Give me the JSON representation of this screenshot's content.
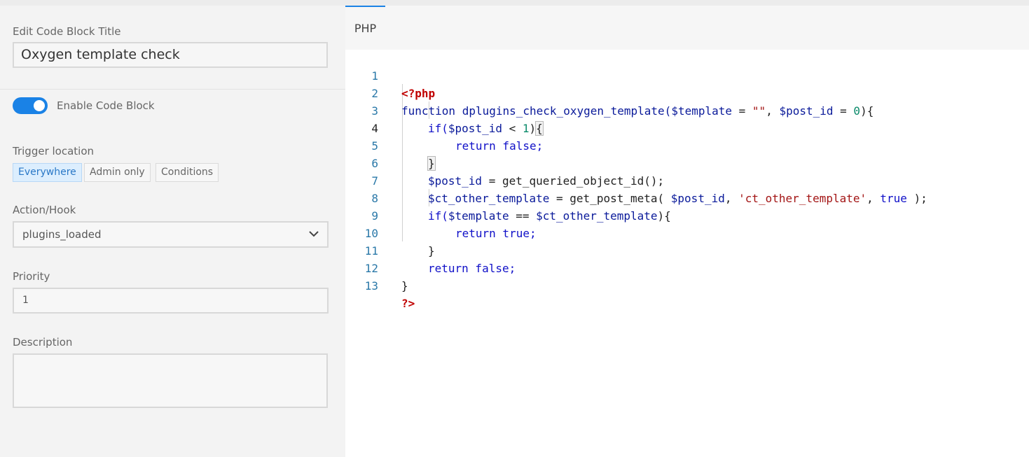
{
  "left": {
    "title_label": "Edit Code Block Title",
    "title_value": "Oxygen template check",
    "enable_label": "Enable Code Block",
    "trigger_label": "Trigger location",
    "trigger_options": [
      "Everywhere",
      "Admin only",
      "Conditions"
    ],
    "action_label": "Action/Hook",
    "action_value": "plugins_loaded",
    "priority_label": "Priority",
    "priority_value": "1",
    "description_label": "Description",
    "description_value": ""
  },
  "editor": {
    "tab": "PHP",
    "lines": [
      "1",
      "2",
      "3",
      "4",
      "5",
      "6",
      "7",
      "8",
      "9",
      "10",
      "11",
      "12",
      "13"
    ],
    "code": {
      "l1": "<?php",
      "l2_fn": "function dplugins_check_oxygen_template(",
      "l2_v1": "$template",
      "l2_eq": " = ",
      "l2_s": "\"\"",
      "l2_c": ", ",
      "l2_v2": "$post_id",
      "l2_eq2": " = ",
      "l2_n": "0",
      "l2_end": "){",
      "l3_kw": "if(",
      "l3_v": "$post_id",
      "l3_op": " < ",
      "l3_n": "1",
      "l3_end": ")",
      "l3_br": "{",
      "l4": "return false;",
      "l5": "}",
      "l6_v": "$post_id",
      "l6_rest": " = get_queried_object_id();",
      "l7_v": "$ct_other_template",
      "l7_mid": " = get_post_meta( ",
      "l7_v2": "$post_id",
      "l7_c": ", ",
      "l7_s": "'ct_other_template'",
      "l7_c2": ", ",
      "l7_t": "true",
      "l7_end": " );",
      "l8_kw": "if(",
      "l8_v": "$template",
      "l8_op": " == ",
      "l8_v2": "$ct_other_template",
      "l8_end": "){",
      "l9": "return true;",
      "l10": "}",
      "l11": "return false;",
      "l12": "}",
      "l13": "?>"
    }
  }
}
